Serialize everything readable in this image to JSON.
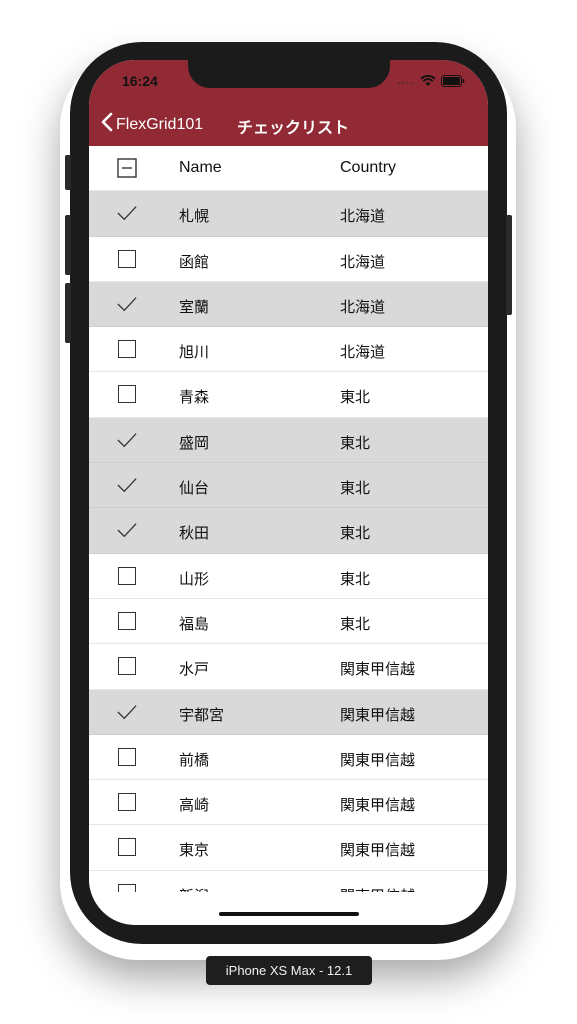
{
  "status_bar": {
    "time": "16:24"
  },
  "nav": {
    "back_label": "FlexGrid101",
    "title": "チェックリスト"
  },
  "grid": {
    "headers": {
      "name": "Name",
      "country": "Country"
    },
    "rows": [
      {
        "name": "札幌",
        "country": "北海道",
        "checked": true
      },
      {
        "name": "函館",
        "country": "北海道",
        "checked": false
      },
      {
        "name": "室蘭",
        "country": "北海道",
        "checked": true
      },
      {
        "name": "旭川",
        "country": "北海道",
        "checked": false
      },
      {
        "name": "青森",
        "country": "東北",
        "checked": false
      },
      {
        "name": "盛岡",
        "country": "東北",
        "checked": true
      },
      {
        "name": "仙台",
        "country": "東北",
        "checked": true
      },
      {
        "name": "秋田",
        "country": "東北",
        "checked": true
      },
      {
        "name": "山形",
        "country": "東北",
        "checked": false
      },
      {
        "name": "福島",
        "country": "東北",
        "checked": false
      },
      {
        "name": "水戸",
        "country": "関東甲信越",
        "checked": false
      },
      {
        "name": "宇都宮",
        "country": "関東甲信越",
        "checked": true
      },
      {
        "name": "前橋",
        "country": "関東甲信越",
        "checked": false
      },
      {
        "name": "高崎",
        "country": "関東甲信越",
        "checked": false
      },
      {
        "name": "東京",
        "country": "関東甲信越",
        "checked": false
      },
      {
        "name": "新潟",
        "country": "関東甲信越",
        "checked": false
      }
    ]
  },
  "device_label": "iPhone XS Max - 12.1",
  "colors": {
    "nav_background": "#922a36",
    "checked_row": "#d9d9d9"
  }
}
